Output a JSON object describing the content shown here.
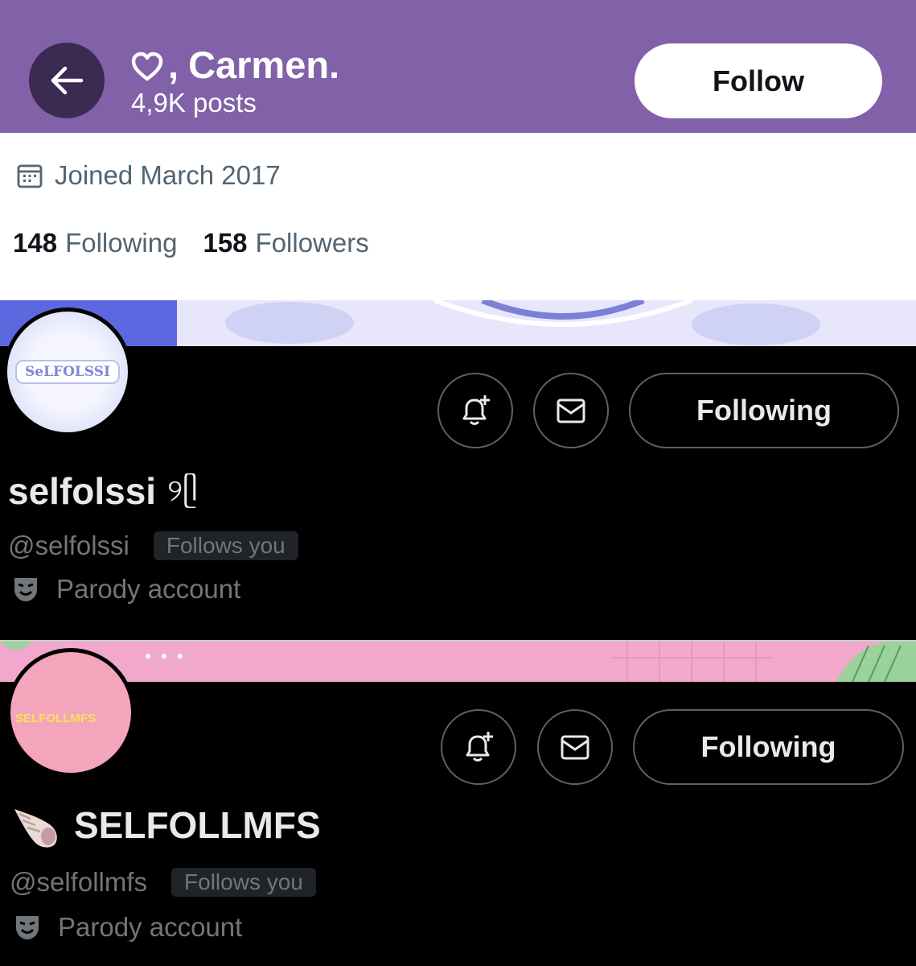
{
  "header": {
    "title": "Carmen.",
    "title_prefix": ",",
    "posts": "4,9K posts",
    "follow_label": "Follow"
  },
  "info": {
    "joined": "Joined March 2017",
    "following_count": "148",
    "following_label": "Following",
    "followers_count": "158",
    "followers_label": "Followers"
  },
  "cards": [
    {
      "avatar_text": "SeLFOLSSI",
      "name": "selfolssi",
      "name_suffix": "୨ᥫ",
      "handle": "@selfolssi",
      "badge": "Follows you",
      "parody": "Parody account",
      "following_label": "Following"
    },
    {
      "avatar_text": "SELFOLLMFS",
      "name": "SELFOLLMFS",
      "handle": "@selfollmfs",
      "badge": "Follows you",
      "parody": "Parody account",
      "following_label": "Following"
    }
  ],
  "colors": {
    "header_bg": "#8161a8",
    "back_button_bg": "#3b2a52",
    "card_bg": "#000000",
    "muted_text": "#71767b"
  },
  "icons": [
    "back-arrow-icon",
    "heart-icon",
    "calendar-icon",
    "bell-plus-icon",
    "mail-icon",
    "theater-mask-icon",
    "shell-emoji"
  ]
}
